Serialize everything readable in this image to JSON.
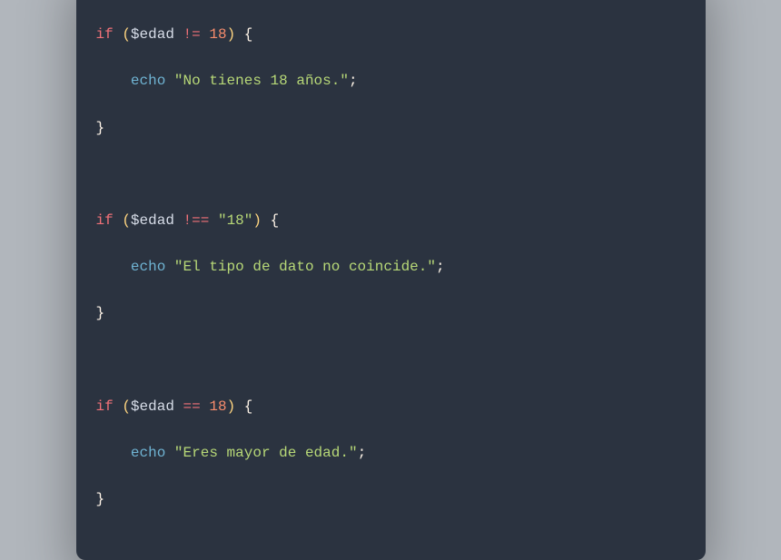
{
  "code": {
    "block1": {
      "if": "if",
      "lparen": "(",
      "var": "$edad",
      "op": "!=",
      "val": "18",
      "rparen": ")",
      "lbrace": "{",
      "echo": "echo",
      "str": "\"No tienes 18 años.\"",
      "semi": ";",
      "rbrace": "}"
    },
    "block2": {
      "if": "if",
      "lparen": "(",
      "var": "$edad",
      "op": "!==",
      "val": "\"18\"",
      "rparen": ")",
      "lbrace": "{",
      "echo": "echo",
      "str": "\"El tipo de dato no coincide.\"",
      "semi": ";",
      "rbrace": "}"
    },
    "block3": {
      "if": "if",
      "lparen": "(",
      "var": "$edad",
      "op": "==",
      "val": "18",
      "rparen": ")",
      "lbrace": "{",
      "echo": "echo",
      "str": "\"Eres mayor de edad.\"",
      "semi": ";",
      "rbrace": "}"
    }
  }
}
